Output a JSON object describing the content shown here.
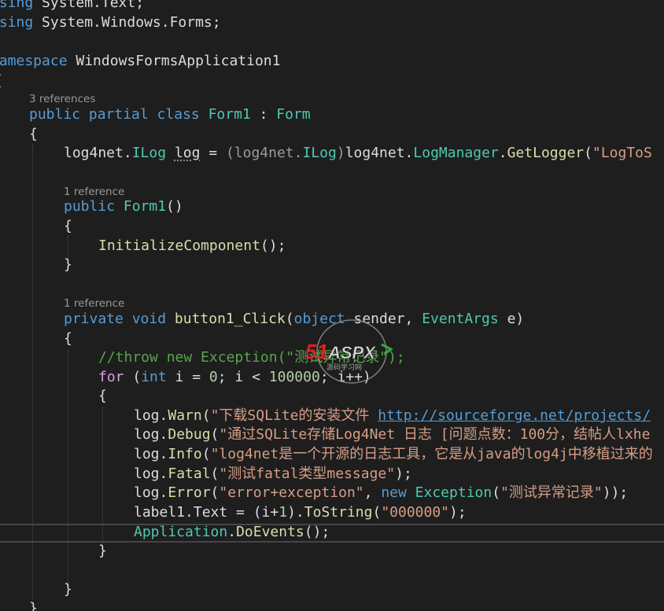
{
  "code": {
    "using_text": {
      "kw": "using",
      "ns": " System.Text;"
    },
    "using_forms": {
      "kw": "using",
      "ns": " System.Windows.Forms;"
    },
    "namespace": {
      "kw": "namespace",
      "name": " WindowsFormsApplication1"
    },
    "brace_open_ns": "{",
    "class_refs": "3 references",
    "class_decl": {
      "mod": "public partial class ",
      "name": "Form1",
      "colon": " : ",
      "base": "Form"
    },
    "brace_open_class": "{",
    "field": {
      "ns1": "log4net.",
      "t1": "ILog",
      "sp": " ",
      "var": "log",
      "eq": " = ",
      "cast_open": "(log4net.",
      "t2": "ILog",
      "cast_close": ")",
      "ns2": "log4net.",
      "t3": "LogManager",
      "dot": ".",
      "fn": "GetLogger",
      "paren": "(",
      "str": "\"LogToS"
    },
    "ctor_refs": "1 reference",
    "ctor_decl": {
      "kw": "public ",
      "name": "Form1",
      "rest": "()"
    },
    "ctor_open": "{",
    "ctor_call": {
      "fn": "InitializeComponent",
      "rest": "();"
    },
    "ctor_close": "}",
    "click_refs": "1 reference",
    "click_decl": {
      "kw": "private void ",
      "name": "button1_Click",
      "p1": "(",
      "t1": "object",
      "p2": " sender, ",
      "t2": "EventArgs",
      "p3": " e)"
    },
    "click_open": "{",
    "comment": "//throw new Exception(\"测试异常记录\");",
    "for_line": {
      "kw": "for",
      "p1": " (",
      "t": "int",
      "p2": " i = ",
      "n1": "0",
      "p3": "; i < ",
      "n2": "100000",
      "p4": "; i++)"
    },
    "for_open": "{",
    "warn": {
      "obj": "log.",
      "fn": "Warn",
      "p": "(",
      "str": "\"下载SQLite的安装文件 ",
      "link": "http://sourceforge.net/projects/"
    },
    "debug": {
      "obj": "log.",
      "fn": "Debug",
      "p": "(",
      "str": "\"通过SQLite存储Log4Net 日志 [问题点数：100分，结帖人lxhe"
    },
    "info": {
      "obj": "log.",
      "fn": "Info",
      "p": "(",
      "str": "\"log4net是一个开源的日志工具，它是从java的log4j中移植过来的"
    },
    "fatal": {
      "obj": "log.",
      "fn": "Fatal",
      "p": "(",
      "str": "\"测试fatal类型message\"",
      "end": ");"
    },
    "error": {
      "obj": "log.",
      "fn": "Error",
      "p": "(",
      "str1": "\"error+exception\"",
      "comma": ", ",
      "kw": "new ",
      "t": "Exception",
      "p2": "(",
      "str2": "\"测试异常记录\"",
      "end": "));"
    },
    "label": {
      "p1": "label1.Text = (i+",
      "n": "1",
      "p2": ").",
      "fn": "ToString",
      "p3": "(",
      "str": "\"000000\"",
      "end": ");"
    },
    "doevents": {
      "t": "Application",
      "dot": ".",
      "fn": "DoEvents",
      "end": "();"
    },
    "for_close": "}",
    "click_close": "}",
    "class_close": "}"
  },
  "watermark": {
    "brand_num": "51",
    "brand_text": "ASPX",
    "sub": "源码学习网"
  },
  "colors": {
    "background": "#1e1e1e",
    "keyword": "#569cd6",
    "control": "#d8a0df",
    "type": "#4ec9b0",
    "method": "#dcdcaa",
    "string": "#d69d85",
    "number": "#b5cea8",
    "comment": "#57a64a",
    "codelens": "#999999"
  }
}
